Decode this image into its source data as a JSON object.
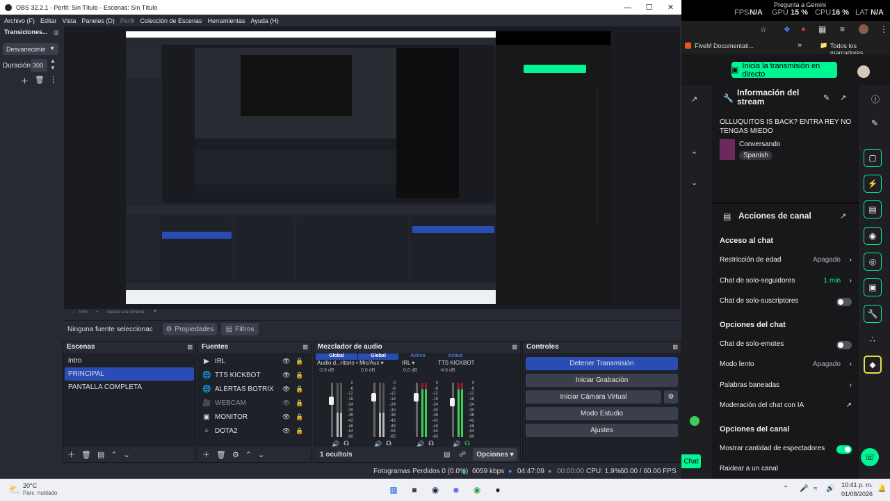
{
  "obs": {
    "title": "OBS 32.2.1 - Perfil: Sin Título - Escenas: Sin Título",
    "menu": [
      "Archivo (F)",
      "Editar",
      "Vista",
      "Paneles (D)",
      "Perfil",
      "Colección de Escenas",
      "Herramientas",
      "Ayuda (H)"
    ],
    "transitions": {
      "title": "Transiciones...",
      "type": "Desvanecimie",
      "duration_label": "Duración",
      "duration_value": "300"
    },
    "zoom": {
      "percent": "54%",
      "fit_label": "Ajustar a la ventana"
    },
    "source_toolbar": {
      "no_source": "Ninguna fuente seleccionac",
      "properties": "Propiedades",
      "filters": "Filtros"
    },
    "scenes": {
      "title": "Escenas",
      "items": [
        "intro",
        "PRINCIPAL",
        "PANTALLA COMPLETA"
      ],
      "selected": "PRINCIPAL"
    },
    "sources": {
      "title": "Fuentes",
      "items": [
        {
          "name": "IRL",
          "icon": "play-icon"
        },
        {
          "name": "TTS KICKBOT",
          "icon": "globe-icon"
        },
        {
          "name": "ALERTAS BOTRIX",
          "icon": "globe-icon"
        },
        {
          "name": "WEBCAM",
          "icon": "camera-icon"
        },
        {
          "name": "MONITOR",
          "icon": "monitor-icon"
        },
        {
          "name": "DOTA2",
          "icon": "gamepad-icon"
        }
      ]
    },
    "mixer": {
      "title": "Mezclador de audio",
      "channels": [
        {
          "header": "Global",
          "name": "Audio d...ritorio",
          "db": "-2.6 dB"
        },
        {
          "header": "Global",
          "name": "Mic/Aux",
          "db": "0.0 dB"
        },
        {
          "header": "Activo",
          "name": "IRL",
          "db": "0.0 dB"
        },
        {
          "header": "Activo",
          "name": "TTS KICKBOT",
          "db": "-4.6 dB"
        }
      ],
      "scale": [
        "0",
        "-6",
        "-12",
        "-18",
        "-24",
        "-30",
        "-36",
        "-42",
        "-48",
        "-54",
        "-60"
      ],
      "hidden": "1 oculto/s",
      "options": "Opciones"
    },
    "controls": {
      "title": "Controles",
      "stop_stream": "Detener Transmisión",
      "start_recording": "Iniciar Grabación",
      "virtual_camera": "Iniciar Cámara Virtual",
      "studio_mode": "Modo Estudio",
      "settings": "Ajustes"
    },
    "status": {
      "dropped": "Fotogramas Perdidos 0 (0.0%)",
      "bitrate": "6059 kbps",
      "stream_time": "04:47:09",
      "rec_time": "00:00:00",
      "cpu": "CPU: 1.9%",
      "fps": "60.00 / 60.00 FPS"
    }
  },
  "overlay": {
    "fps": "FPS",
    "fps_val": "N/A",
    "gpu": "GPU",
    "gpu_val": "15 %",
    "cpu": "CPU",
    "cpu_val": "16 %",
    "lat": "LAT",
    "lat_val": "N/A",
    "gemini": "Pregunta a Gemini"
  },
  "browser": {
    "bookmark1": "FiveM Documentati...",
    "bookmarks_all": "Todos los marcadores",
    "go_live": "Inicia la transmisión en directo",
    "stream_info_title": "Información del stream",
    "stream_title": "OLLUQUITOS IS BACK? ENTRA REY NO TENGAS MIEDO",
    "category": "Conversando",
    "language": "Spanish",
    "actions_title": "Acciones de canal",
    "chat_access": "Acceso al chat",
    "age_restriction": "Restricción de edad",
    "age_value": "Apagado",
    "followers_only": "Chat de solo-seguidores",
    "followers_value": "1 min",
    "subs_only": "Chat de solo-suscriptores",
    "chat_options": "Opciones del chat",
    "emotes_only": "Chat de solo-emotes",
    "slow_mode": "Modo lento",
    "slow_value": "Apagado",
    "banned_words": "Palabras baneadas",
    "ai_moderation": "Moderación del chat con IA",
    "channel_options": "Opciones del canal",
    "show_viewers": "Mostrar cantidad de espectadores",
    "raid": "Raidear a un canal",
    "chat_btn": "Chat"
  },
  "taskbar": {
    "temp": "20°C",
    "weather": "Parc. nublado",
    "time": "10:41 p. m.",
    "date": "01/08/2026"
  }
}
